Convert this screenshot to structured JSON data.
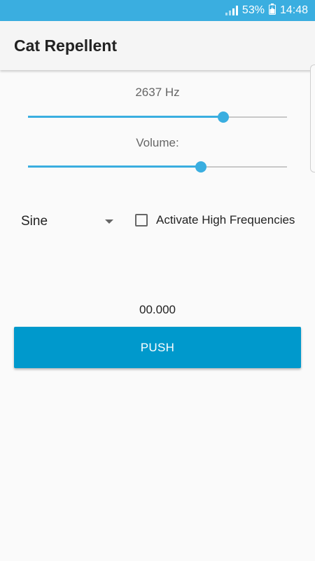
{
  "status_bar": {
    "battery_percent": "53%",
    "time": "14:48",
    "signal_icon": "signal-icon",
    "battery_icon": "battery-charging-icon"
  },
  "app_bar": {
    "title": "Cat Repellent"
  },
  "frequency": {
    "label": "2637 Hz",
    "slider_fraction": 0.754
  },
  "volume": {
    "label": "Volume:",
    "slider_fraction": 0.668
  },
  "waveform": {
    "selected": "Sine",
    "arrow_icon": "dropdown-arrow-icon"
  },
  "high_freq": {
    "label": "Activate High Frequencies",
    "checked": false
  },
  "timer": {
    "value": "00.000"
  },
  "push_button": {
    "label": "PUSH"
  },
  "colors": {
    "accent": "#3aaee0",
    "button": "#0099cc",
    "status_bar": "#3aaee0"
  }
}
